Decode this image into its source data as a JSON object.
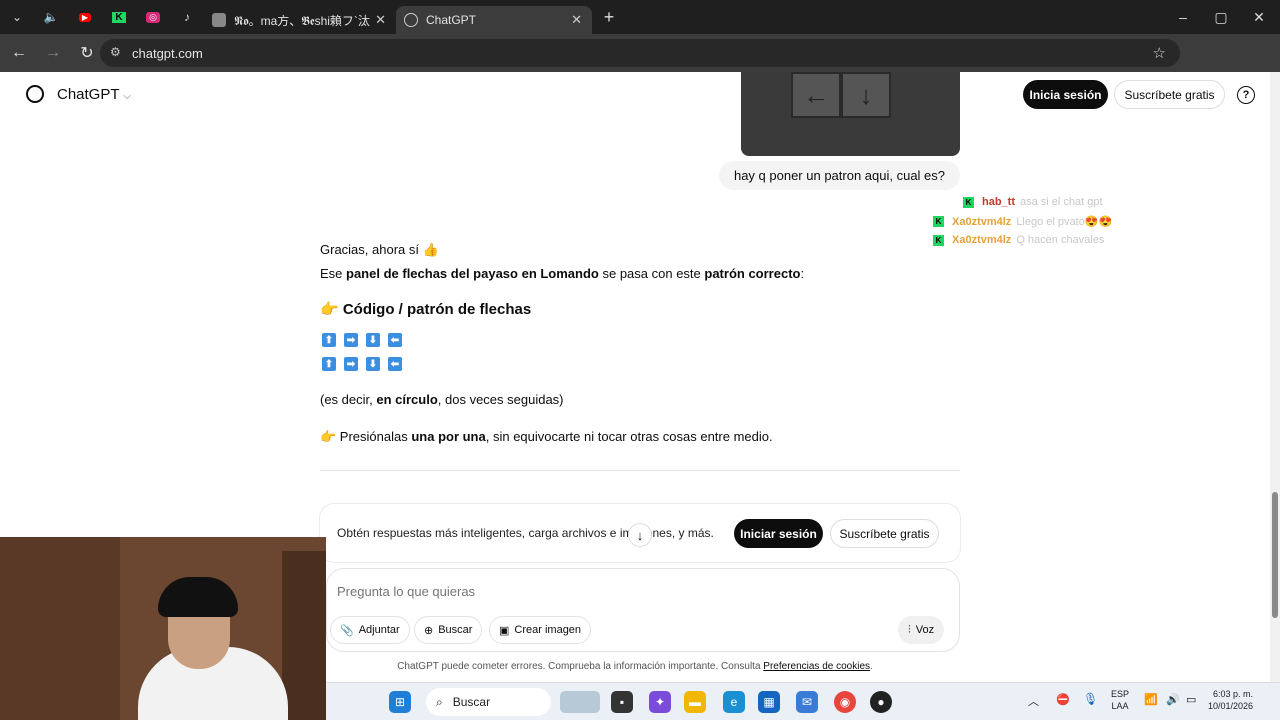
{
  "browser": {
    "tabs": [
      {
        "title": "𝕹𝖔。ma⽅、𝕭𝖊shi賴フ`汰",
        "active": false
      },
      {
        "title": "ChatGPT",
        "active": true
      }
    ],
    "new_tab": "+",
    "url": "chatgpt.com",
    "window": {
      "min": "–",
      "max": "▢",
      "close": "✕"
    }
  },
  "header": {
    "brand": "ChatGPT",
    "login_button": "Inicia sesión",
    "signup_button": "Suscríbete gratis",
    "help": "?"
  },
  "user_message": "hay q poner un patron aqui, cual es?",
  "keypad_keys": [
    "←",
    "↓"
  ],
  "stream_chat": [
    {
      "user": "hab_tt",
      "message": "asa si el chat gpt",
      "color": "#c0392b"
    },
    {
      "user": "Xa0ztvm4lz",
      "message": "Llego el pvato😍😍",
      "color": "#e6a23c"
    },
    {
      "user": "Xa0ztvm4lz",
      "message": "Q hacen chavales",
      "color": "#e6a23c"
    }
  ],
  "assistant": {
    "line1": "Gracias, ahora sí 👍",
    "line2": {
      "a": "Ese ",
      "b": "panel de flechas del payaso en Lomando",
      "c": " se pasa con este ",
      "d": "patrón correcto",
      "e": ":"
    },
    "heading": "👉 Código / patrón de flechas",
    "pattern_row1": [
      "⬆",
      "➡",
      "⬇",
      "⬅"
    ],
    "pattern_row2": [
      "⬆",
      "➡",
      "⬇",
      "⬅"
    ],
    "note": {
      "a": "(es decir, ",
      "b": "en círculo",
      "c": ", dos veces seguidas)"
    },
    "instruction": {
      "a": "👉 Presiónalas ",
      "b": "una por una",
      "c": ", sin equivocarte ni tocar otras cosas entre medio."
    }
  },
  "login_card": {
    "text": "Obtén respuestas más inteligentes, carga archivos e imágenes, y más.",
    "login": "Iniciar sesión",
    "signup": "Suscríbete gratis"
  },
  "composer": {
    "placeholder": "Pregunta lo que quieras",
    "attach": "Adjuntar",
    "search": "Buscar",
    "image": "Crear imagen",
    "voice": "Voz"
  },
  "footer": {
    "text": "ChatGPT puede cometer errores. Comprueba la información importante. Consulta ",
    "link": "Preferencias de cookies",
    "end": "."
  },
  "taskbar": {
    "search": "Buscar",
    "lang1": "ESP",
    "lang2": "LAA",
    "time": "6:03 p. m.",
    "date": "10/01/2026"
  }
}
